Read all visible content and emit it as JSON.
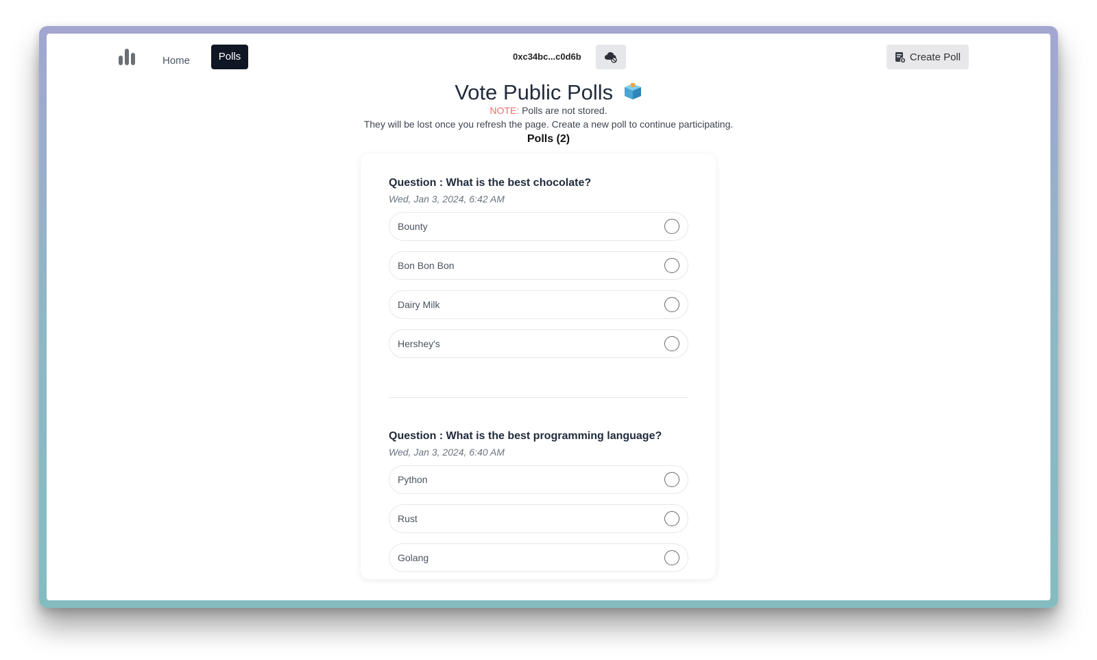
{
  "nav": {
    "logo_icon": "bar-chart-icon",
    "home_label": "Home",
    "polls_label": "Polls",
    "wallet_address": "0xc34bc...c0d6b",
    "cloud_icon": "cloud-blocked-icon",
    "create_poll_label": "Create Poll",
    "create_poll_icon": "add-document-icon"
  },
  "header": {
    "title": "Vote Public Polls",
    "title_icon": "ballot-box-icon",
    "note_label": "NOTE:",
    "note_text": " Polls are not stored.",
    "subtext": "They will be lost once you refresh the page. Create a new poll to continue participating.",
    "poll_count": "Polls (2)"
  },
  "polls": [
    {
      "question": "Question : What is the best chocolate?",
      "date": "Wed, Jan 3, 2024, 6:42 AM",
      "options": [
        "Bounty",
        "Bon Bon Bon",
        "Dairy Milk",
        "Hershey's"
      ]
    },
    {
      "question": "Question : What is the best programming language?",
      "date": "Wed, Jan 3, 2024, 6:40 AM",
      "options": [
        "Python",
        "Rust",
        "Golang"
      ]
    }
  ],
  "colors": {
    "accent": "#0f1724",
    "note": "#f26b6b"
  }
}
